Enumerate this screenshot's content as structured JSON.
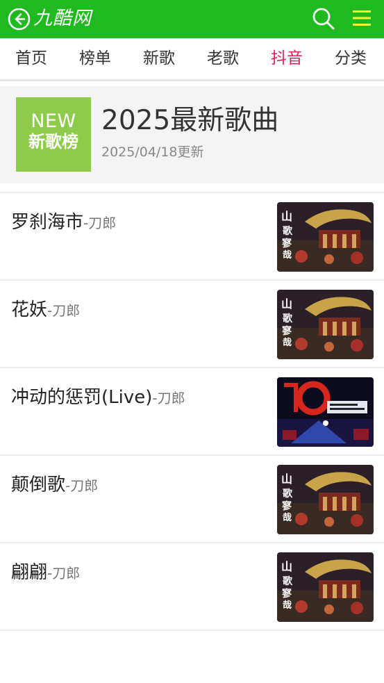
{
  "app": {
    "logo_text": "九酷网"
  },
  "icons": {
    "back": "back-arrow-circle-icon",
    "search": "search-icon",
    "menu": "hamburger-menu-icon"
  },
  "colors": {
    "brand_green": "#1fba1f",
    "active_tab": "#e8205a",
    "badge_green": "#8fcb4a",
    "menu_yellow": "#f5f53a"
  },
  "nav": {
    "tabs": [
      {
        "label": "首页",
        "active": false
      },
      {
        "label": "榜单",
        "active": false
      },
      {
        "label": "新歌",
        "active": false
      },
      {
        "label": "老歌",
        "active": false
      },
      {
        "label": "抖音",
        "active": true
      },
      {
        "label": "分类",
        "active": false
      }
    ]
  },
  "playlist": {
    "badge_new": "NEW",
    "badge_title": "新歌榜",
    "title": "2025最新歌曲",
    "updated": "2025/04/18更新"
  },
  "songs": [
    {
      "title": "罗刹海市",
      "artist": "-刀郎",
      "cover": "album-cover-山歌寥哉"
    },
    {
      "title": "花妖",
      "artist": "-刀郎",
      "cover": "album-cover-山歌寥哉"
    },
    {
      "title": "冲动的惩罚(Live)",
      "artist": "-刀郎",
      "cover": "album-cover-concert"
    },
    {
      "title": "颠倒歌",
      "artist": "-刀郎",
      "cover": "album-cover-山歌寥哉"
    },
    {
      "title": "翩翩",
      "artist": "-刀郎",
      "cover": "album-cover-山歌寥哉"
    }
  ]
}
